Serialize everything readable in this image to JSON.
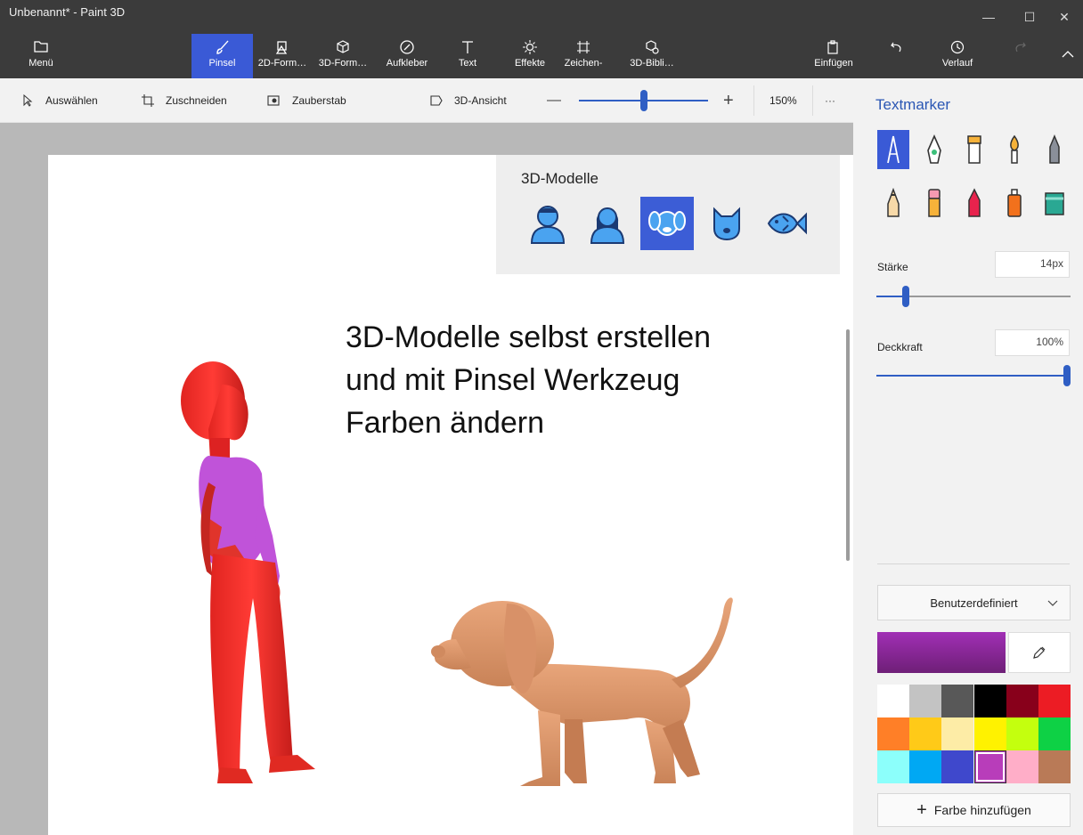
{
  "window": {
    "title": "Unbenannt* - Paint 3D",
    "minimize_glyph": "—",
    "maximize_glyph": "☐",
    "close_glyph": "✕"
  },
  "ribbon": {
    "menu": "Menü",
    "tools": [
      "Pinsel",
      "2D-Form…",
      "3D-Form…",
      "Aufkleber",
      "Text",
      "Effekte",
      "Zeichen-",
      "3D-Bibli…"
    ],
    "paste": "Einfügen",
    "history": "Verlauf",
    "active_tool": "Pinsel"
  },
  "subbar": {
    "select": "Auswählen",
    "crop": "Zuschneiden",
    "magic": "Zauberstab",
    "view3d": "3D-Ansicht",
    "minus": "—",
    "plus": "+",
    "zoom": "150%",
    "more": "···",
    "zoom_slider_level": 0.5
  },
  "models_popup": {
    "title": "3D-Modelle",
    "items": [
      "man-model-icon",
      "woman-model-icon",
      "dog-model-icon",
      "cat-model-icon",
      "fish-model-icon"
    ],
    "selected": "dog-model-icon"
  },
  "canvas": {
    "text_lines": [
      "3D-Modelle selbst erstellen",
      "und mit Pinsel Werkzeug",
      "Farben ändern"
    ]
  },
  "panel": {
    "title": "Textmarker",
    "brushes": [
      "marker",
      "calligraphy-pen",
      "oil-brush",
      "watercolor",
      "pixel-pen",
      "pencil",
      "eraser",
      "crayon",
      "spray-can",
      "fill"
    ],
    "selected_brush": "marker",
    "thickness_label": "Stärke",
    "thickness_value": "14px",
    "thickness_level": 0.14,
    "opacity_label": "Deckkraft",
    "opacity_value": "100%",
    "opacity_level": 1.0,
    "dropdown": "Benutzerdefiniert",
    "current_color": "#a12fb5",
    "palette": [
      "#ffffff",
      "#c3c3c3",
      "#585858",
      "#000000",
      "#88001b",
      "#ec1c24",
      "#ff7f27",
      "#ffca18",
      "#fdeca6",
      "#fff200",
      "#c4ff0e",
      "#0ed145",
      "#8cfffb",
      "#00a8f3",
      "#3f48cc",
      "#b83dba",
      "#ffaec8",
      "#b97a57"
    ],
    "selected_swatch": "#b83dba",
    "add_color": "Farbe hinzufügen"
  }
}
